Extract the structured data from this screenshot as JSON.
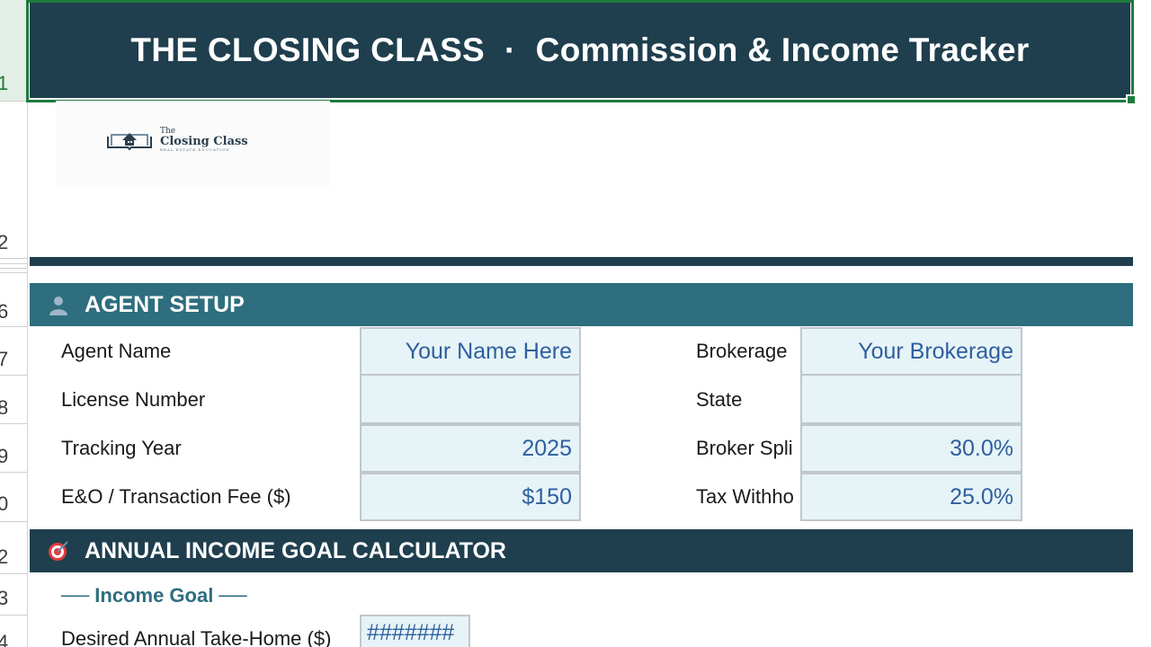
{
  "title": {
    "left": "THE CLOSING CLASS",
    "separator": "·",
    "right": "Commission & Income Tracker"
  },
  "row_headers": [
    "1",
    "2",
    "6",
    "7",
    "8",
    "9",
    "0",
    "2",
    "3",
    "4"
  ],
  "logo": {
    "line1": "The",
    "line2": "Closing Class",
    "line3": "REAL ESTATE EDUCATION"
  },
  "agent_setup": {
    "header": "AGENT SETUP",
    "icon": "person-icon",
    "fields_left": [
      {
        "label": "Agent Name",
        "value": "Your Name Here"
      },
      {
        "label": "License Number",
        "value": ""
      },
      {
        "label": "Tracking Year",
        "value": "2025"
      },
      {
        "label": "E&O / Transaction Fee ($)",
        "value": "$150"
      }
    ],
    "fields_right": [
      {
        "label": "Brokerage",
        "value": "Your Brokerage"
      },
      {
        "label": "State",
        "value": ""
      },
      {
        "label": "Broker Spli",
        "value": "30.0%"
      },
      {
        "label": "Tax Withho",
        "value": "25.0%"
      }
    ]
  },
  "goal_calculator": {
    "header": "ANNUAL INCOME GOAL CALCULATOR",
    "icon": "target-icon",
    "subheading": "── Income Goal ──",
    "desired_label": "Desired Annual Take-Home ($)",
    "desired_value": "#######"
  },
  "colors": {
    "dark_navy": "#1f3f4e",
    "teal": "#2e6e7e",
    "input_bg": "#e6f3f7",
    "input_text": "#2f5f9e",
    "selection_green": "#1e7a3c"
  }
}
